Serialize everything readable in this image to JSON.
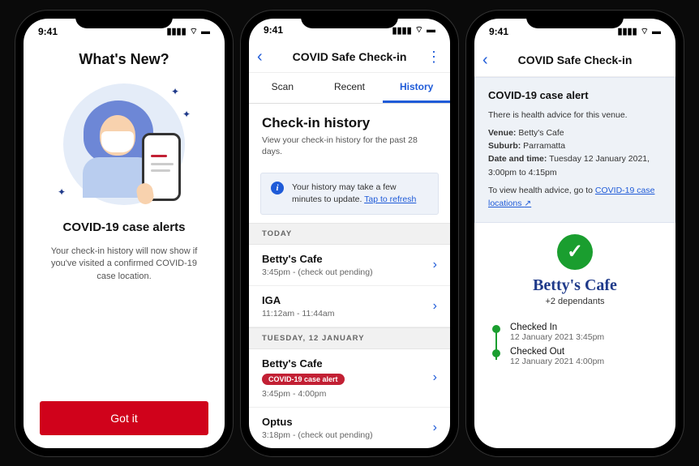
{
  "status": {
    "time": "9:41"
  },
  "phone1": {
    "title": "What's New?",
    "subtitle": "COVID-19 case alerts",
    "description": "Your check-in history will now show if you've visited a confirmed COVID-19 case location.",
    "button": "Got it"
  },
  "phone2": {
    "nav_title": "COVID Safe Check-in",
    "tabs": {
      "scan": "Scan",
      "recent": "Recent",
      "history": "History"
    },
    "heading": "Check-in history",
    "subheading": "View your check-in history for the past 28 days.",
    "info_text": "Your history may take a few minutes to update. ",
    "info_link": "Tap to refresh",
    "sections": [
      {
        "label": "TODAY",
        "rows": [
          {
            "name": "Betty's Cafe",
            "time": "3:45pm - (check out pending)",
            "alert": false
          },
          {
            "name": "IGA",
            "time": "11:12am - 11:44am",
            "alert": false
          }
        ]
      },
      {
        "label": "TUESDAY, 12 JANUARY",
        "rows": [
          {
            "name": "Betty's Cafe",
            "time": "3:45pm - 4:00pm",
            "alert": true,
            "alert_label": "COVID-19 case alert"
          },
          {
            "name": "Optus",
            "time": "3:18pm - (check out pending)",
            "alert": false
          }
        ]
      }
    ]
  },
  "phone3": {
    "nav_title": "COVID Safe Check-in",
    "box": {
      "heading": "COVID-19 case alert",
      "intro": "There is health advice for this venue.",
      "venue_label": "Venue:",
      "venue": "Betty's Cafe",
      "suburb_label": "Suburb:",
      "suburb": "Parramatta",
      "dt_label": "Date and time:",
      "dt": "Tuesday 12 January 2021, 3:00pm to 4:15pm",
      "advice_pre": "To view health advice, go to ",
      "advice_link": "COVID-19 case locations"
    },
    "venue_name": "Betty's Cafe",
    "dependants": "+2 dependants",
    "checkin": {
      "label": "Checked In",
      "dt": "12 January 2021 3:45pm"
    },
    "checkout": {
      "label": "Checked Out",
      "dt": "12 January 2021 4:00pm"
    }
  }
}
